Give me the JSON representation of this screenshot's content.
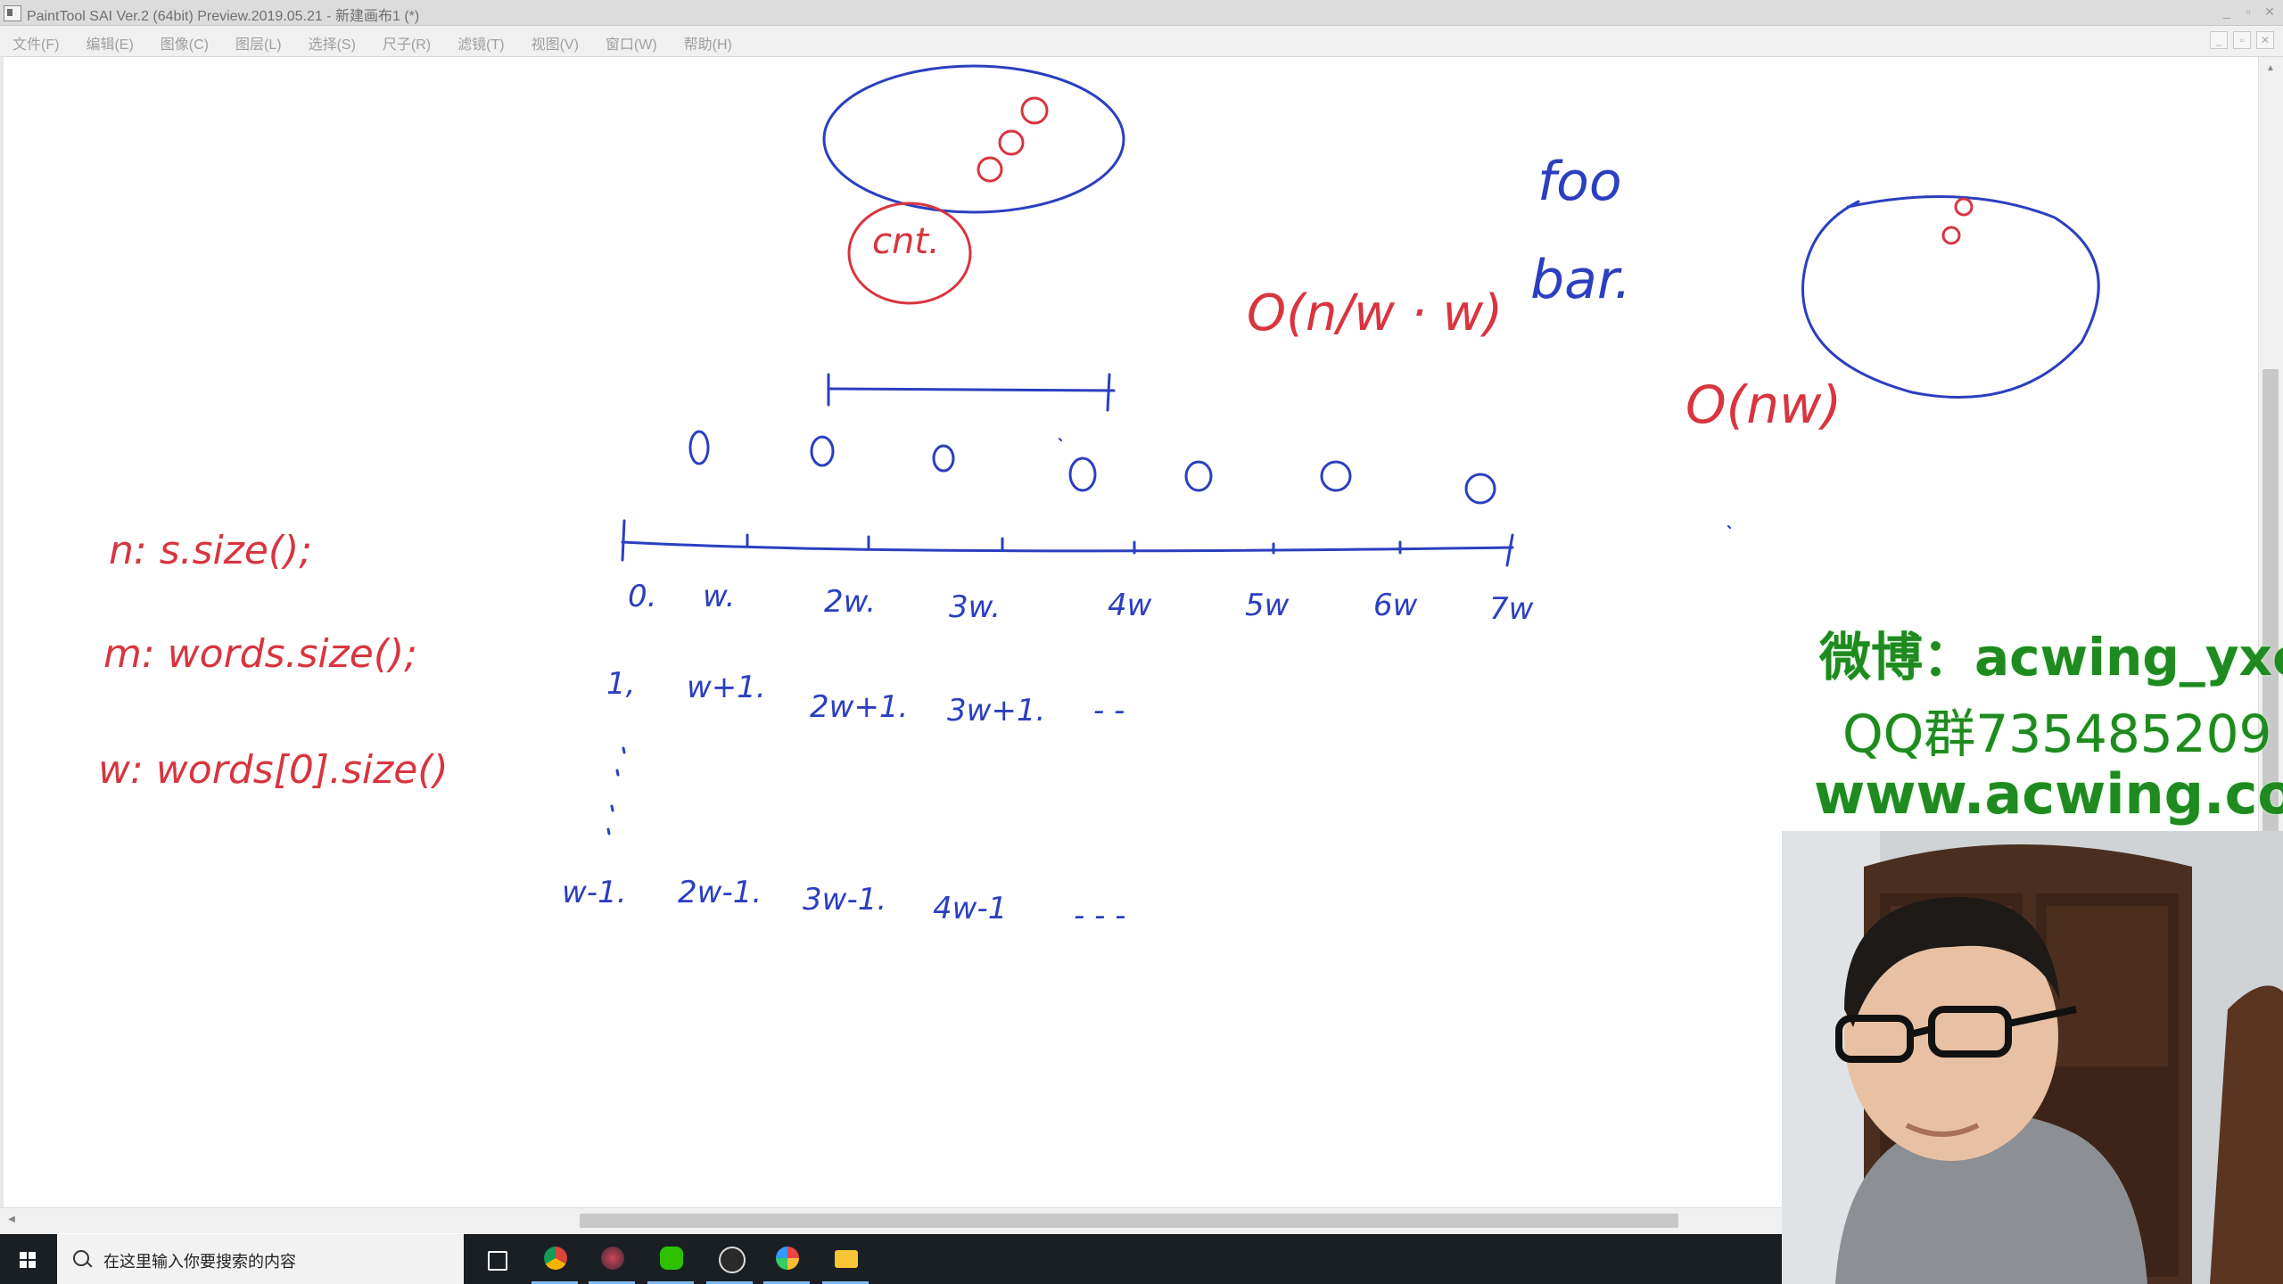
{
  "window": {
    "title": "PaintTool SAI Ver.2 (64bit) Preview.2019.05.21 - 新建画布1 (*)",
    "controls": [
      "_",
      "▫",
      "✕"
    ]
  },
  "menu": {
    "items": [
      "文件(F)",
      "编辑(E)",
      "图像(C)",
      "图层(L)",
      "选择(S)",
      "尺子(R)",
      "滤镜(T)",
      "视图(V)",
      "窗口(W)",
      "帮助(H)"
    ]
  },
  "canvas": {
    "red_notes": [
      "n: s.size();",
      "m: words.size();",
      "w: words[0].size()"
    ],
    "red_complexity_1": "O(n/w · w)",
    "red_complexity_2": "O(nw)",
    "red_cnt": "cnt.",
    "blue_foo": "foo",
    "blue_bar": "bar.",
    "axis_labels": [
      "0.",
      "w.",
      "2w.",
      "3w.",
      "4w",
      "5w",
      "6w",
      "7w"
    ],
    "row2": [
      "1,",
      "w+1.",
      "2w+1.",
      "3w+1.",
      "- -"
    ],
    "row3": [
      "w-1.",
      "2w-1.",
      "3w-1.",
      "4w-1",
      "- - -"
    ],
    "circles_label": "0"
  },
  "watermark": {
    "weibo": "微博：acwing_yxc",
    "qq": "QQ群735485209",
    "site": "www.acwing.com"
  },
  "taskbar": {
    "search_placeholder": "在这里输入你要搜索的内容",
    "apps": [
      "task-view-icon",
      "chrome-icon",
      "media-icon",
      "wechat-icon",
      "obs-icon",
      "paint-icon",
      "file-explorer-icon"
    ]
  },
  "colors": {
    "ink_blue": "#2b3fbf",
    "ink_red": "#d8353f",
    "watermark_green": "#1f8a1f"
  }
}
